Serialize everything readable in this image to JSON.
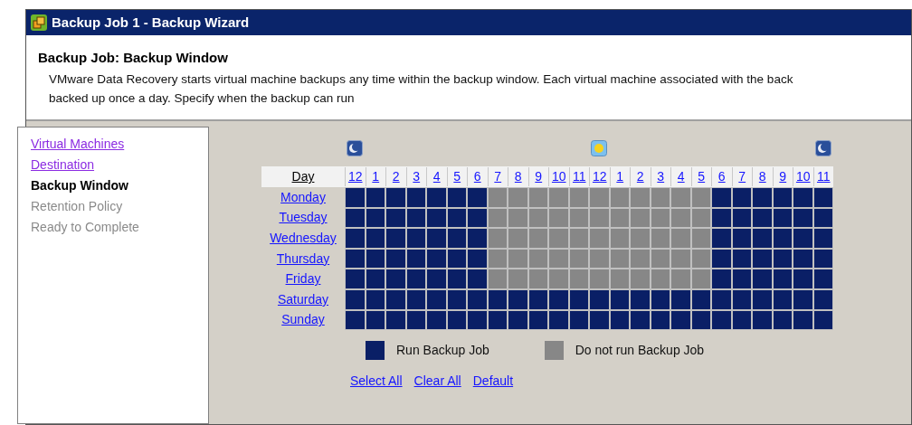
{
  "window": {
    "title": "Backup Job 1 - Backup Wizard"
  },
  "header": {
    "title": "Backup Job: Backup Window",
    "description_lines": [
      "VMware Data Recovery starts virtual machine backups any time within the backup window.  Each virtual machine associated with the back",
      "backed up once a day.  Specify when the backup can run"
    ]
  },
  "sidebar": {
    "items": [
      {
        "label": "Virtual Machines",
        "kind": "link"
      },
      {
        "label": "Destination",
        "kind": "link"
      },
      {
        "label": "Backup Window",
        "kind": "current"
      },
      {
        "label": "Retention Policy",
        "kind": "disabled"
      },
      {
        "label": "Ready to Complete",
        "kind": "disabled"
      }
    ]
  },
  "schedule": {
    "day_header": "Day",
    "hour_markers": [
      {
        "kind": "moon"
      },
      {
        "kind": "none"
      },
      {
        "kind": "none"
      },
      {
        "kind": "none"
      },
      {
        "kind": "none"
      },
      {
        "kind": "none"
      },
      {
        "kind": "none"
      },
      {
        "kind": "none"
      },
      {
        "kind": "none"
      },
      {
        "kind": "none"
      },
      {
        "kind": "none"
      },
      {
        "kind": "none"
      },
      {
        "kind": "sun"
      },
      {
        "kind": "none"
      },
      {
        "kind": "none"
      },
      {
        "kind": "none"
      },
      {
        "kind": "none"
      },
      {
        "kind": "none"
      },
      {
        "kind": "none"
      },
      {
        "kind": "none"
      },
      {
        "kind": "none"
      },
      {
        "kind": "none"
      },
      {
        "kind": "none"
      },
      {
        "kind": "moon"
      }
    ],
    "hours": [
      "12",
      "1",
      "2",
      "3",
      "4",
      "5",
      "6",
      "7",
      "8",
      "9",
      "10",
      "11",
      "12",
      "1",
      "2",
      "3",
      "4",
      "5",
      "6",
      "7",
      "8",
      "9",
      "10",
      "11"
    ],
    "days": [
      {
        "label": "Monday",
        "slots": [
          true,
          true,
          true,
          true,
          true,
          true,
          true,
          false,
          false,
          false,
          false,
          false,
          false,
          false,
          false,
          false,
          false,
          false,
          true,
          true,
          true,
          true,
          true,
          true
        ]
      },
      {
        "label": "Tuesday",
        "slots": [
          true,
          true,
          true,
          true,
          true,
          true,
          true,
          false,
          false,
          false,
          false,
          false,
          false,
          false,
          false,
          false,
          false,
          false,
          true,
          true,
          true,
          true,
          true,
          true
        ]
      },
      {
        "label": "Wednesday",
        "slots": [
          true,
          true,
          true,
          true,
          true,
          true,
          true,
          false,
          false,
          false,
          false,
          false,
          false,
          false,
          false,
          false,
          false,
          false,
          true,
          true,
          true,
          true,
          true,
          true
        ]
      },
      {
        "label": "Thursday",
        "slots": [
          true,
          true,
          true,
          true,
          true,
          true,
          true,
          false,
          false,
          false,
          false,
          false,
          false,
          false,
          false,
          false,
          false,
          false,
          true,
          true,
          true,
          true,
          true,
          true
        ]
      },
      {
        "label": "Friday",
        "slots": [
          true,
          true,
          true,
          true,
          true,
          true,
          true,
          false,
          false,
          false,
          false,
          false,
          false,
          false,
          false,
          false,
          false,
          false,
          true,
          true,
          true,
          true,
          true,
          true
        ]
      },
      {
        "label": "Saturday",
        "slots": [
          true,
          true,
          true,
          true,
          true,
          true,
          true,
          true,
          true,
          true,
          true,
          true,
          true,
          true,
          true,
          true,
          true,
          true,
          true,
          true,
          true,
          true,
          true,
          true
        ]
      },
      {
        "label": "Sunday",
        "slots": [
          true,
          true,
          true,
          true,
          true,
          true,
          true,
          true,
          true,
          true,
          true,
          true,
          true,
          true,
          true,
          true,
          true,
          true,
          true,
          true,
          true,
          true,
          true,
          true
        ]
      }
    ],
    "legend": [
      {
        "label": "Run Backup Job",
        "color": "#0a1f66"
      },
      {
        "label": "Do not run Backup Job",
        "color": "#878787"
      }
    ],
    "actions": [
      "Select All",
      "Clear All",
      "Default"
    ]
  }
}
